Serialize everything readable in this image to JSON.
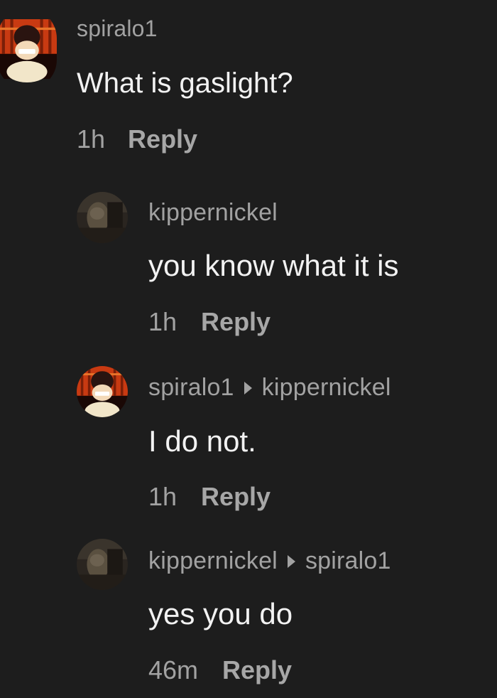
{
  "comments": [
    {
      "username": "spiralo1",
      "reply_to": "",
      "text": "What is gaslight?",
      "time": "1h",
      "reply_label": "Reply",
      "avatar": "spiralo1-avatar"
    },
    {
      "username": "kippernickel",
      "reply_to": "",
      "text": "you know what it is",
      "time": "1h",
      "reply_label": "Reply",
      "avatar": "kippernickel-avatar"
    },
    {
      "username": "spiralo1",
      "reply_to": "kippernickel",
      "text": "I do not.",
      "time": "1h",
      "reply_label": "Reply",
      "avatar": "spiralo1-avatar"
    },
    {
      "username": "kippernickel",
      "reply_to": "spiralo1",
      "text": "yes you do",
      "time": "46m",
      "reply_label": "Reply",
      "avatar": "kippernickel-avatar"
    }
  ],
  "colors": {
    "background": "#1d1d1d",
    "text": "#f2f2f2",
    "muted": "#a2a2a2"
  }
}
